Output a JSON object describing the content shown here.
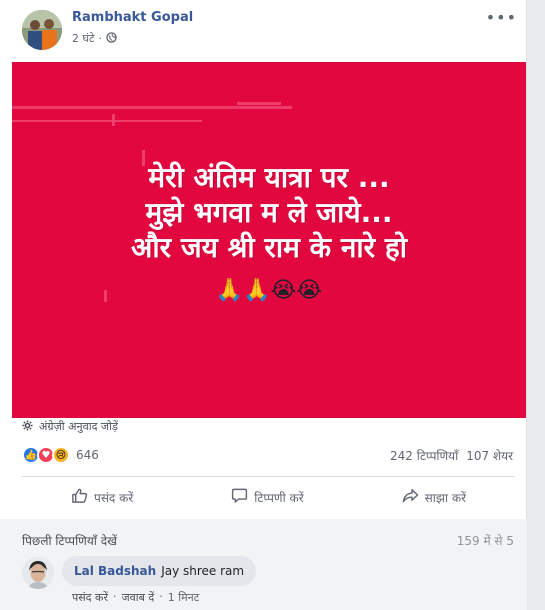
{
  "post": {
    "author": "Rambhakt Gopal",
    "time": "2 घंटे",
    "image_lines": [
      "मेरी अंतिम यात्रा पर ...",
      "मुझे भगवा म ले जाये...",
      "और जय श्री राम के नारे हो"
    ],
    "image_emojis": "🙏🙏😭😭",
    "translate_label": "अंग्रेज़ी अनुवाद जोड़ें",
    "reaction_count": "646",
    "comments_count": "242 टिप्पणियाँ",
    "shares_count": "107 शेयर",
    "colors": {
      "image_bg": "#e3073f",
      "link": "#385898"
    }
  },
  "actions": {
    "like": "पसंद करें",
    "comment": "टिप्पणी करें",
    "share": "साझा करें"
  },
  "comments": {
    "view_previous": "पिछली टिप्पणियाँ देखें",
    "count_label": "159 में से 5",
    "items": [
      {
        "name": "Lal Badshah",
        "text": "Jay shree ram",
        "like": "पसंद करें",
        "reply": "जवाब दें",
        "time": "1 मिनट"
      }
    ]
  }
}
